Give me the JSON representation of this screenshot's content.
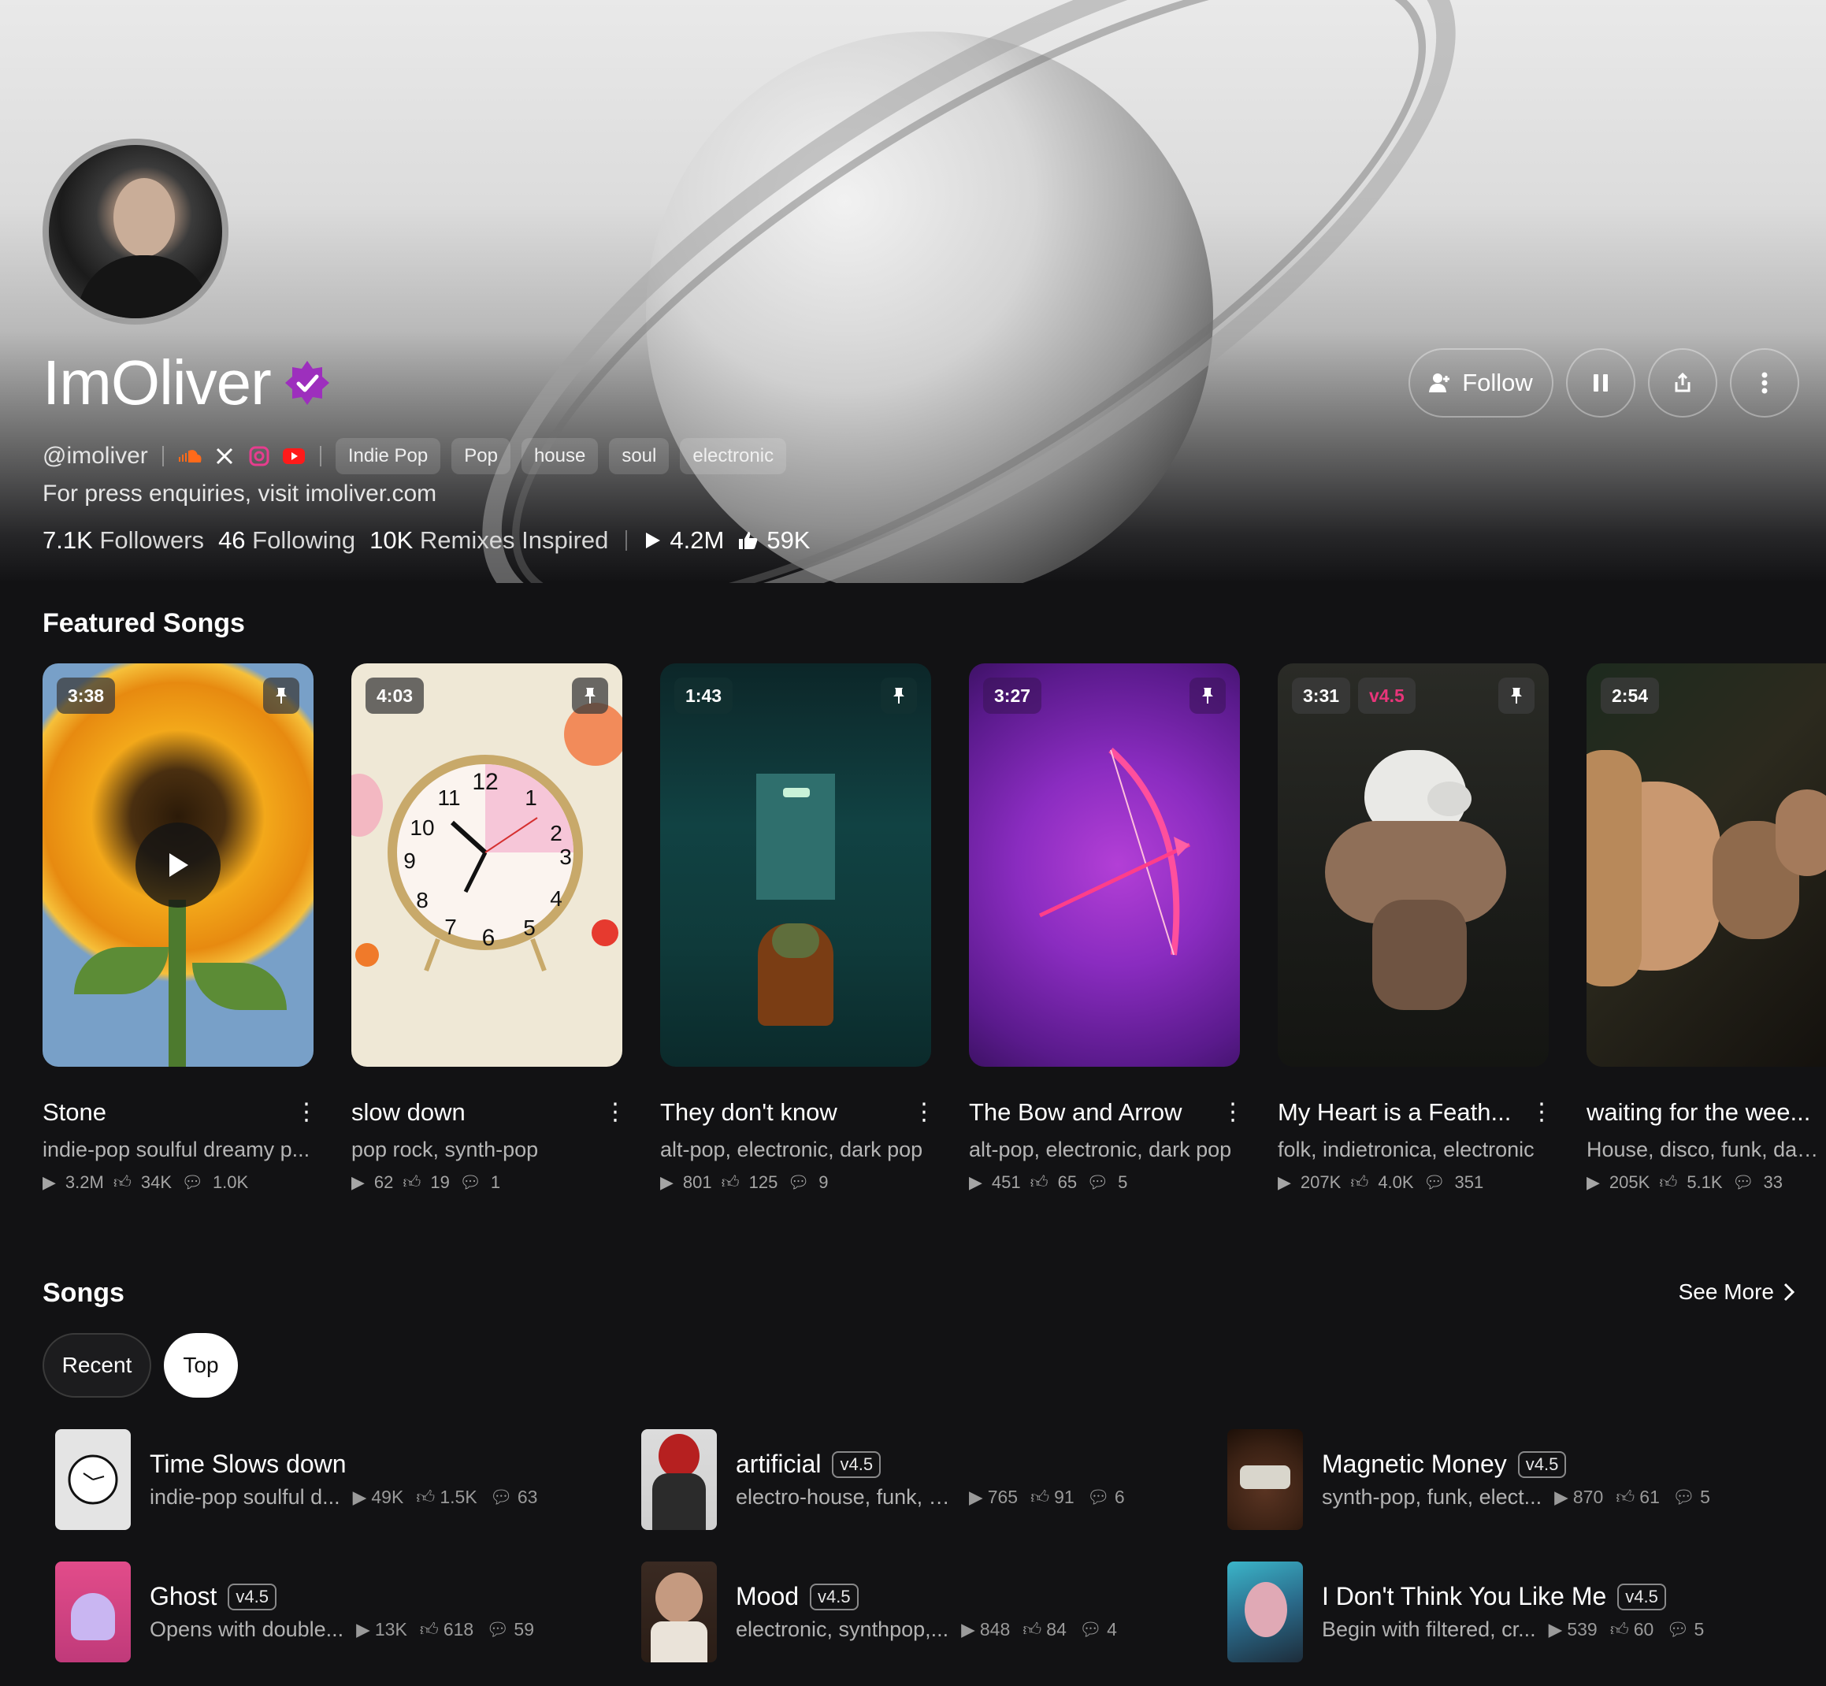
{
  "profile": {
    "name": "ImOliver",
    "handle": "@imoliver",
    "tags": [
      "Indie Pop",
      "Pop",
      "house",
      "soul",
      "electronic"
    ],
    "bio": "For press enquiries, visit imoliver.com",
    "followers_count": "7.1K",
    "followers_label": "Followers",
    "following_count": "46",
    "following_label": "Following",
    "remixes_count": "10K",
    "remixes_label": "Remixes Inspired",
    "plays": "4.2M",
    "likes": "59K",
    "follow_label": "Follow",
    "social_icons": [
      "soundcloud-icon",
      "x-icon",
      "instagram-icon",
      "youtube-icon"
    ]
  },
  "featured": {
    "title": "Featured Songs",
    "items": [
      {
        "duration": "3:38",
        "title": "Stone",
        "genre": "indie-pop soulful dreamy p...",
        "plays": "3.2M",
        "likes": "34K",
        "comments": "1.0K",
        "version": ""
      },
      {
        "duration": "4:03",
        "title": "slow down",
        "genre": "pop rock, synth-pop",
        "plays": "62",
        "likes": "19",
        "comments": "1",
        "version": ""
      },
      {
        "duration": "1:43",
        "title": "They don't know",
        "genre": "alt-pop, electronic, dark pop",
        "plays": "801",
        "likes": "125",
        "comments": "9",
        "version": ""
      },
      {
        "duration": "3:27",
        "title": "The Bow and Arrow",
        "genre": "alt-pop, electronic, dark pop",
        "plays": "451",
        "likes": "65",
        "comments": "5",
        "version": ""
      },
      {
        "duration": "3:31",
        "title": "My Heart is a Feath...",
        "genre": "folk, indietronica, electronic",
        "plays": "207K",
        "likes": "4.0K",
        "comments": "351",
        "version": "v4.5"
      },
      {
        "duration": "2:54",
        "title": "waiting for the wee...",
        "genre": "House, disco, funk, dance",
        "plays": "205K",
        "likes": "5.1K",
        "comments": "33",
        "version": ""
      }
    ]
  },
  "songs": {
    "title": "Songs",
    "see_more": "See More",
    "filters": [
      "Recent",
      "Top"
    ],
    "active_filter": "Top",
    "items": [
      {
        "title": "Time Slows down",
        "version": "",
        "genre": "indie-pop soulful d...",
        "plays": "49K",
        "likes": "1.5K",
        "comments": "63"
      },
      {
        "title": "artificial",
        "version": "v4.5",
        "genre": "electro-house, funk, e...",
        "plays": "765",
        "likes": "91",
        "comments": "6"
      },
      {
        "title": "Magnetic Money",
        "version": "v4.5",
        "genre": "synth-pop, funk, elect...",
        "plays": "870",
        "likes": "61",
        "comments": "5"
      },
      {
        "title": "Ghost",
        "version": "v4.5",
        "genre": "Opens with double...",
        "plays": "13K",
        "likes": "618",
        "comments": "59"
      },
      {
        "title": "Mood",
        "version": "v4.5",
        "genre": "electronic, synthpop,...",
        "plays": "848",
        "likes": "84",
        "comments": "4"
      },
      {
        "title": "I Don't Think You Like Me",
        "version": "v4.5",
        "genre": "Begin with filtered, cr...",
        "plays": "539",
        "likes": "60",
        "comments": "5"
      }
    ]
  },
  "colors": {
    "background": "#121214",
    "accent_version": "#e8357a",
    "verified_badge": "#a030c0"
  }
}
